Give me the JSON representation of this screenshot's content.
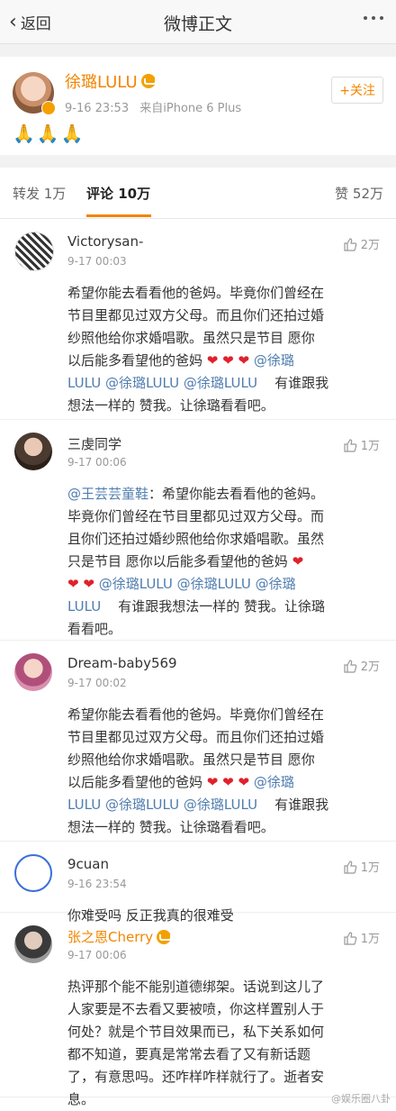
{
  "nav": {
    "back_label": "返回",
    "title": "微博正文"
  },
  "post": {
    "author": "徐璐LULU",
    "time": "9-16 23:53",
    "source": "来自iPhone 6 Plus",
    "follow_label": "关注",
    "text": "🙏🙏🙏"
  },
  "tabs": {
    "repost": "转发 1万",
    "comments": "评论 10万",
    "likes": "赞 52万"
  },
  "comments": [
    {
      "name": "Victorysan-",
      "time": "9-17 00:03",
      "likes": "2万",
      "lines": [
        "希望你能去看看他的爸妈。毕竟你们曾经在",
        "节目里都见过双方父母。而且你们还拍过婚",
        "纱照他给你求婚唱歌。虽然只是节目    愿你",
        "以后能多看望他的爸妈",
        "@徐璐",
        "LULU @徐璐LULU @徐璐LULU",
        "有谁跟我",
        "想法一样的 赞我。让徐璐看看吧。"
      ]
    },
    {
      "name": "三虔同学",
      "time": "9-17 00:06",
      "likes": "1万",
      "lines": [
        "@王芸芸童鞋",
        "：希望你能去看看他的爸妈。",
        "毕竟你们曾经在节目里都见过双方父母。而",
        "且你们还拍过婚纱照他给你求婚唱歌。虽然",
        "只是节目     愿你以后能多看望他的爸妈",
        "@徐璐LULU @徐璐LULU @徐璐",
        "LULU",
        "有谁跟我想法一样的 赞我。让徐璐",
        "看看吧。"
      ]
    },
    {
      "name": "Dream-baby569",
      "time": "9-17 00:02",
      "likes": "2万",
      "lines": [
        "希望你能去看看他的爸妈。毕竟你们曾经在",
        "节目里都见过双方父母。而且你们还拍过婚",
        "纱照他给你求婚唱歌。虽然只是节目     愿你",
        "以后能多看望他的爸妈",
        "@徐璐",
        "LULU @徐璐LULU @徐璐LULU",
        "有谁跟我",
        "想法一样的 赞我。让徐璐看看吧。"
      ]
    },
    {
      "name": "9cuan",
      "time": "9-16 23:54",
      "likes": "1万",
      "lines": [
        "你难受吗   反正我真的很难受"
      ]
    },
    {
      "name": "张之恩Cherry",
      "time": "9-17 00:06",
      "likes": "1万",
      "lines": [
        "热评那个能不能别道德绑架。话说到这儿了",
        "人家要是不去看又要被喷，你这样置别人于",
        "何处？就是个节目效果而已，私下关系如何",
        "都不知道，要真是常常去看了又有新话题",
        "了，有意思吗。还咋样咋样就行了。逝者安",
        "息。"
      ]
    }
  ],
  "heart_glyph": "❤",
  "watermark": "@娱乐圈八卦",
  "colors": {
    "accent": "#f28500",
    "mention": "#507daf",
    "heart": "#e0212b"
  }
}
